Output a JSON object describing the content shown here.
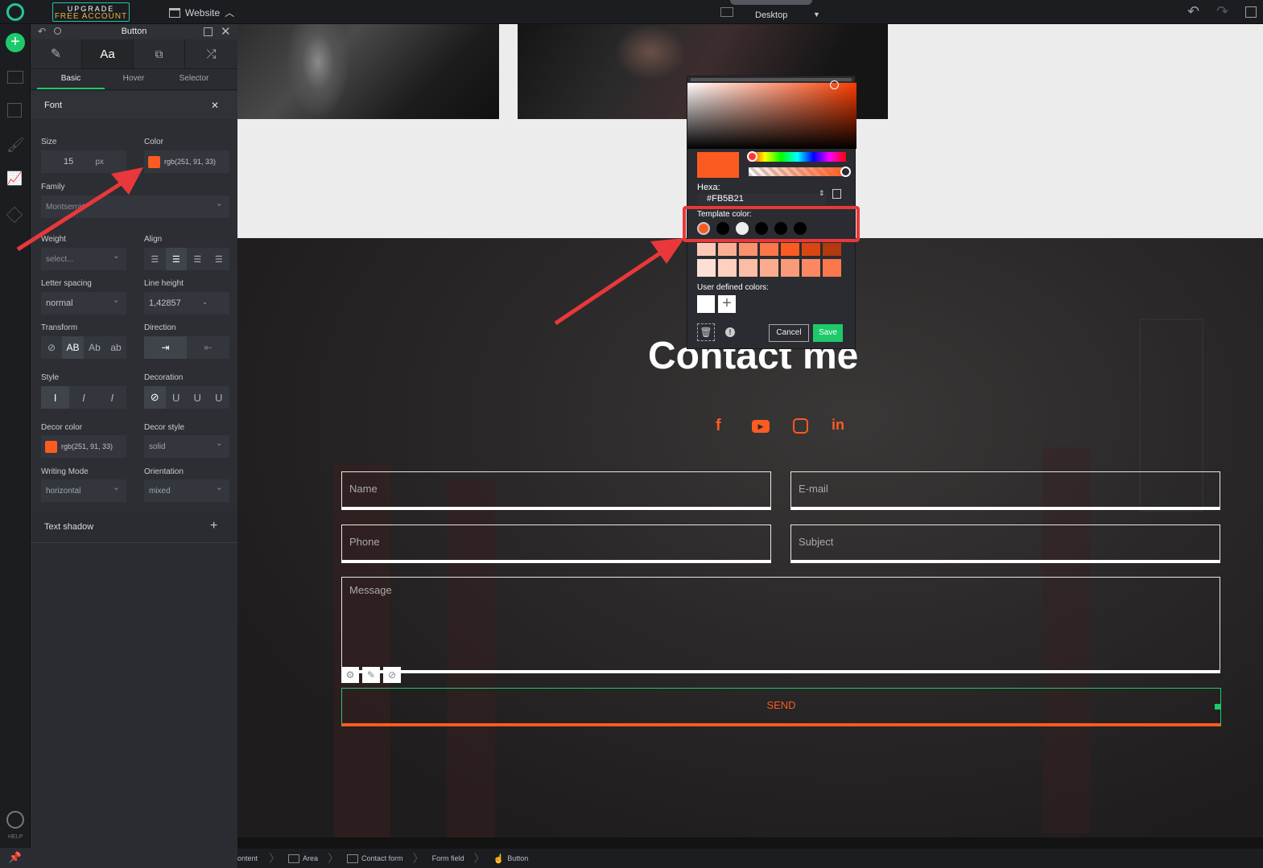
{
  "topbar": {
    "upgrade_line1": "UPGRADE",
    "upgrade_line2": "FREE ACCOUNT",
    "website_label": "Website",
    "device_label": "Desktop"
  },
  "leftbar": {
    "help_label": "HELP"
  },
  "panel": {
    "title": "Button",
    "tabs": [
      "Basic",
      "Hover",
      "Selector"
    ],
    "section_title": "Font",
    "size_label": "Size",
    "size_value": "15",
    "size_unit": "px",
    "color_label": "Color",
    "color_value": "rgb(251, 91, 33)",
    "family_label": "Family",
    "family_value": "Montserrat",
    "weight_label": "Weight",
    "weight_value": "select...",
    "align_label": "Align",
    "letter_spacing_label": "Letter spacing",
    "letter_spacing_value": "normal",
    "line_height_label": "Line height",
    "line_height_value": "1,42857",
    "line_height_unit": "-",
    "transform_label": "Transform",
    "transform_options": [
      "AB",
      "Ab",
      "ab"
    ],
    "direction_label": "Direction",
    "style_label": "Style",
    "decoration_label": "Decoration",
    "decor_color_label": "Decor color",
    "decor_color_value": "rgb(251, 91, 33)",
    "decor_style_label": "Decor style",
    "decor_style_value": "solid",
    "writing_mode_label": "Writing Mode",
    "writing_mode_value": "horizontal",
    "orientation_label": "Orientation",
    "orientation_value": "mixed",
    "text_shadow_label": "Text shadow"
  },
  "picker": {
    "hexa_label": "Hexa:",
    "hexa_value": "#FB5B21",
    "template_label": "Template color:",
    "user_label": "User defined colors:",
    "cancel_label": "Cancel",
    "save_label": "Save",
    "template_colors": [
      "#fb5b21",
      "#000000",
      "#eeeeee",
      "#000000",
      "#000000",
      "#000000"
    ],
    "shades_row1": [
      "#fdc9b6",
      "#fcae92",
      "#fc926d",
      "#fb7749",
      "#fb5b21",
      "#d94612",
      "#b3390e",
      "#8c2c0b"
    ],
    "shades_row2": [
      "#fde0d5",
      "#fdd0bf",
      "#fcbda6",
      "#fbac90",
      "#fb9a78",
      "#fb8863",
      "#fb774c",
      "#fb6838"
    ]
  },
  "site": {
    "heading": "Contact me",
    "name_placeholder": "Name",
    "email_placeholder": "E-mail",
    "phone_placeholder": "Phone",
    "subject_placeholder": "Subject",
    "message_placeholder": "Message",
    "send_label": "SEND"
  },
  "breadcrumb": [
    "ontent",
    "Area",
    "Contact form",
    "Form field",
    "Button"
  ],
  "colors": {
    "accent": "#fb5b21",
    "save": "#1ec96b",
    "annotation": "#e8383b",
    "brand": "#23c6a0"
  }
}
